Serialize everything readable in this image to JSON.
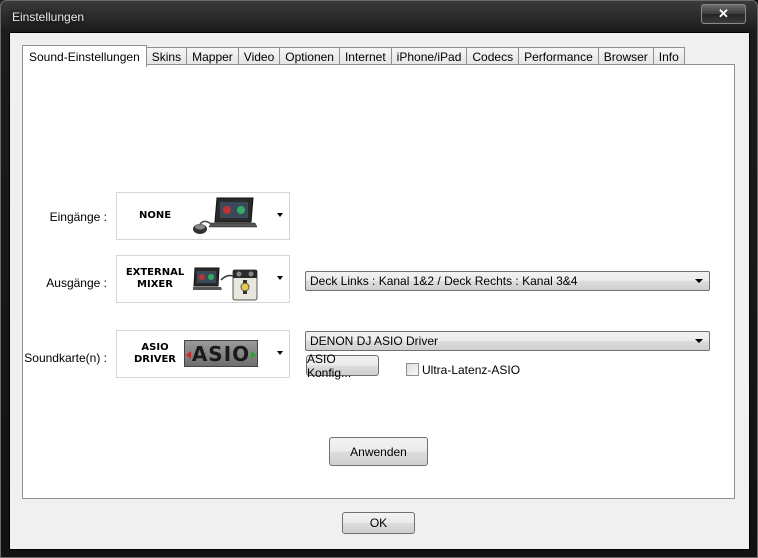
{
  "window": {
    "title": "Einstellungen",
    "close_label": "✕"
  },
  "tabs": [
    {
      "label": "Sound-Einstellungen",
      "active": true
    },
    {
      "label": "Skins"
    },
    {
      "label": "Mapper"
    },
    {
      "label": "Video"
    },
    {
      "label": "Optionen"
    },
    {
      "label": "Internet"
    },
    {
      "label": "iPhone/iPad"
    },
    {
      "label": "Codecs"
    },
    {
      "label": "Performance"
    },
    {
      "label": "Browser"
    },
    {
      "label": "Info"
    }
  ],
  "inputs": {
    "label": "Eingänge :",
    "device_name": "NONE"
  },
  "outputs": {
    "label": "Ausgänge :",
    "device_name_line1": "EXTERNAL",
    "device_name_line2": "MIXER",
    "routing_value": "Deck Links : Kanal 1&2 / Deck Rechts : Kanal 3&4"
  },
  "soundcard": {
    "label": "Soundkarte(n) :",
    "device_name_line1": "ASIO",
    "device_name_line2": "DRIVER",
    "logo_text": "ASIO",
    "driver_value": "DENON DJ ASIO Driver",
    "config_button": "ASIO Konfig...",
    "ultra_latency_label": "Ultra-Latenz-ASIO",
    "ultra_latency_checked": false
  },
  "apply_button": "Anwenden",
  "ok_button": "OK"
}
